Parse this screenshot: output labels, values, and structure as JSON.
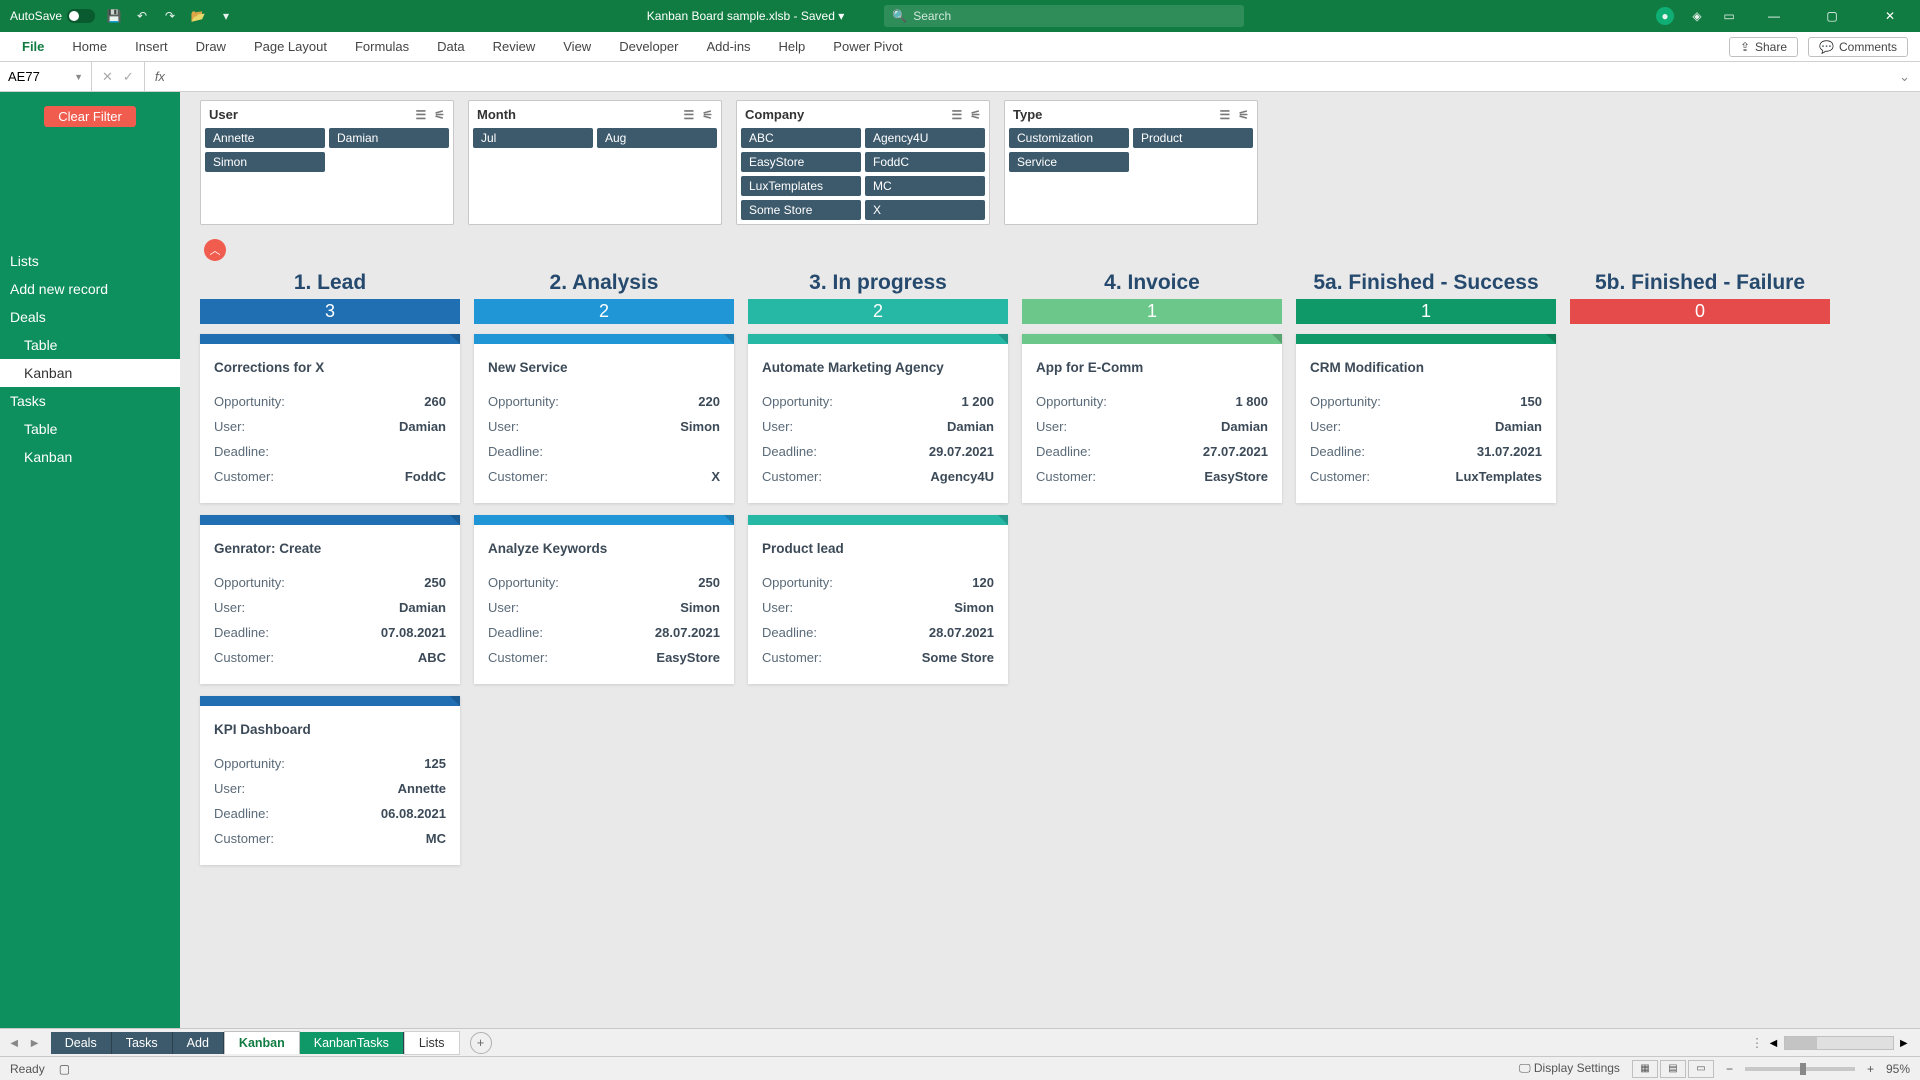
{
  "titlebar": {
    "autosave_label": "AutoSave",
    "doc_title": "Kanban Board sample.xlsb - Saved ▾",
    "search_placeholder": "Search"
  },
  "ribbon": {
    "tabs": [
      "File",
      "Home",
      "Insert",
      "Draw",
      "Page Layout",
      "Formulas",
      "Data",
      "Review",
      "View",
      "Developer",
      "Add-ins",
      "Help",
      "Power Pivot"
    ],
    "share": "Share",
    "comments": "Comments"
  },
  "namebox": {
    "cell": "AE77",
    "fx": "fx"
  },
  "sidebar": {
    "clear_filter": "Clear Filter",
    "items": [
      {
        "label": "Lists",
        "sub": false,
        "active": false
      },
      {
        "label": "Add new record",
        "sub": false,
        "active": false
      },
      {
        "label": "Deals",
        "sub": false,
        "active": false
      },
      {
        "label": "Table",
        "sub": true,
        "active": false
      },
      {
        "label": "Kanban",
        "sub": true,
        "active": true
      },
      {
        "label": "Tasks",
        "sub": false,
        "active": false
      },
      {
        "label": "Table",
        "sub": true,
        "active": false
      },
      {
        "label": "Kanban",
        "sub": true,
        "active": false
      }
    ]
  },
  "slicers": [
    {
      "name": "User",
      "items": [
        "Annette",
        "Damian",
        "Simon",
        ""
      ]
    },
    {
      "name": "Month",
      "items": [
        "Jul",
        "Aug"
      ]
    },
    {
      "name": "Company",
      "items": [
        "ABC",
        "Agency4U",
        "EasyStore",
        "FoddC",
        "LuxTemplates",
        "MC",
        "Some Store",
        "X"
      ]
    },
    {
      "name": "Type",
      "items": [
        "Customization",
        "Product",
        "Service",
        ""
      ]
    }
  ],
  "kanban": {
    "columns": [
      {
        "title": "1. Lead",
        "count": "3",
        "color": "c-blue-d",
        "cards": [
          {
            "title": "Corrections for X",
            "opportunity": "260",
            "user": "Damian",
            "deadline": "",
            "customer": "FoddC"
          },
          {
            "title": "Genrator: Create",
            "opportunity": "250",
            "user": "Damian",
            "deadline": "07.08.2021",
            "customer": "ABC"
          },
          {
            "title": "KPI Dashboard",
            "opportunity": "125",
            "user": "Annette",
            "deadline": "06.08.2021",
            "customer": "MC"
          }
        ]
      },
      {
        "title": "2. Analysis",
        "count": "2",
        "color": "c-blue",
        "cards": [
          {
            "title": "New Service",
            "opportunity": "220",
            "user": "Simon",
            "deadline": "",
            "customer": "X"
          },
          {
            "title": "Analyze Keywords",
            "opportunity": "250",
            "user": "Simon",
            "deadline": "28.07.2021",
            "customer": "EasyStore"
          }
        ]
      },
      {
        "title": "3. In progress",
        "count": "2",
        "color": "c-teal",
        "cards": [
          {
            "title": "Automate Marketing Agency",
            "opportunity": "1 200",
            "user": "Damian",
            "deadline": "29.07.2021",
            "customer": "Agency4U"
          },
          {
            "title": "Product lead",
            "opportunity": "120",
            "user": "Simon",
            "deadline": "28.07.2021",
            "customer": "Some Store"
          }
        ]
      },
      {
        "title": "4. Invoice",
        "count": "1",
        "color": "c-green",
        "cards": [
          {
            "title": "App for E-Comm",
            "opportunity": "1 800",
            "user": "Damian",
            "deadline": "27.07.2021",
            "customer": "EasyStore"
          }
        ]
      },
      {
        "title": "5a. Finished - Success",
        "count": "1",
        "color": "c-dgreen",
        "cards": [
          {
            "title": "CRM Modification",
            "opportunity": "150",
            "user": "Damian",
            "deadline": "31.07.2021",
            "customer": "LuxTemplates"
          }
        ]
      },
      {
        "title": "5b. Finished - Failure",
        "count": "0",
        "color": "c-red",
        "cards": []
      }
    ],
    "labels": {
      "opportunity": "Opportunity:",
      "user": "User:",
      "deadline": "Deadline:",
      "customer": "Customer:"
    }
  },
  "sheet_tabs": [
    "Deals",
    "Tasks",
    "Add",
    "Kanban",
    "KanbanTasks",
    "Lists"
  ],
  "statusbar": {
    "ready": "Ready",
    "display": "Display Settings",
    "zoom": "95%"
  }
}
